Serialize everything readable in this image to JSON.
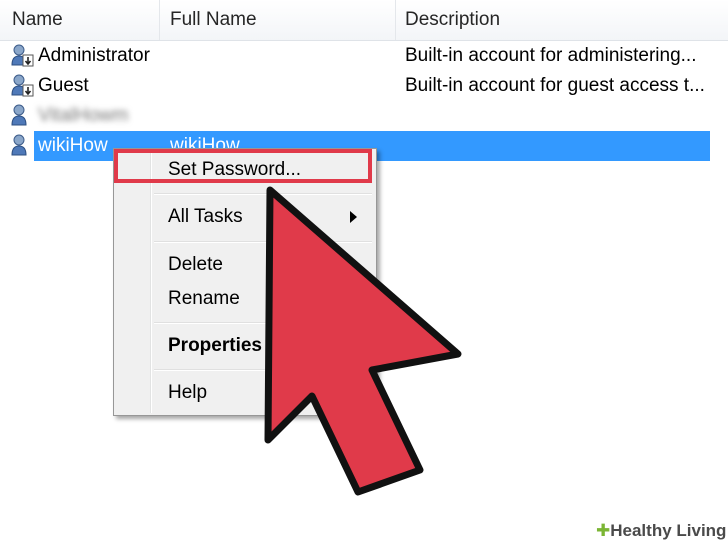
{
  "columns": {
    "name": "Name",
    "full_name": "Full Name",
    "description": "Description"
  },
  "users": [
    {
      "name": "Administrator",
      "full_name": "",
      "description": "Built-in account for administering..."
    },
    {
      "name": "Guest",
      "full_name": "",
      "description": "Built-in account for guest access t..."
    },
    {
      "name": "VitalHowm",
      "full_name": "",
      "description": ""
    },
    {
      "name": "wikiHow",
      "full_name": "wikiHow",
      "description": ""
    }
  ],
  "context_menu": {
    "set_password": "Set Password...",
    "all_tasks": "All Tasks",
    "delete": "Delete",
    "rename": "Rename",
    "properties": "Properties",
    "help": "Help"
  },
  "colors": {
    "selection": "#3399ff",
    "annotation_red": "#e03a4a"
  },
  "watermark": {
    "brand": "Healthy Living"
  }
}
